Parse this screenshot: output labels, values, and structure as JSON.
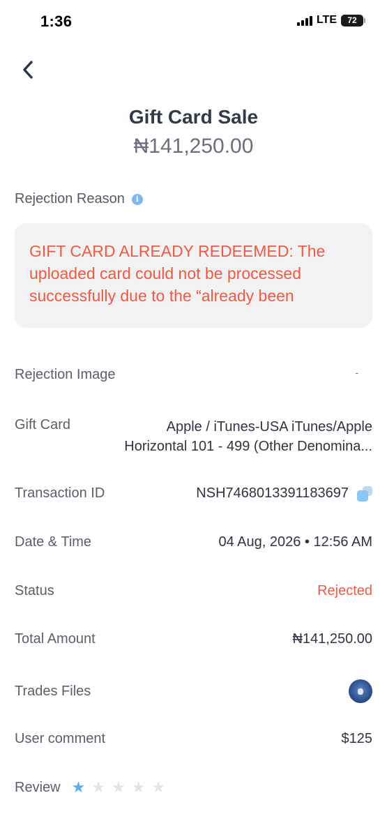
{
  "status_bar": {
    "time": "1:36",
    "network": "LTE",
    "battery": "72"
  },
  "header": {
    "title": "Gift Card Sale",
    "amount": "₦141,250.00"
  },
  "rejection": {
    "label": "Rejection Reason",
    "text": "GIFT CARD ALREADY REDEEMED: The uploaded card could not be processed successfully due to the “already been redeemed” message received. Kindly"
  },
  "details": {
    "rejection_image": {
      "label": "Rejection Image",
      "value": "-"
    },
    "gift_card": {
      "label": "Gift Card",
      "value_line1": "Apple / iTunes-USA iTunes/Apple",
      "value_line2": "Horizontal 101 - 499 (Other Denomina..."
    },
    "transaction_id": {
      "label": "Transaction ID",
      "value": "NSH7468013391183697"
    },
    "date_time": {
      "label": "Date & Time",
      "value": "04 Aug, 2026 • 12:56 AM"
    },
    "status": {
      "label": "Status",
      "value": "Rejected",
      "color": "#ee5a45"
    },
    "total_amount": {
      "label": "Total Amount",
      "value": "₦141,250.00"
    },
    "trades_files": {
      "label": "Trades Files"
    },
    "user_comment": {
      "label": "User comment",
      "value": "$125"
    },
    "review": {
      "label": "Review",
      "rating": 1,
      "max": 5
    }
  },
  "colors": {
    "accent": "#5aaff0",
    "error": "#ee5a45"
  }
}
